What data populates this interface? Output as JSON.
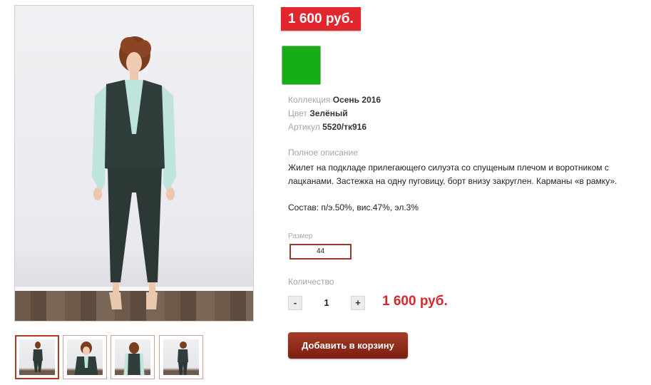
{
  "product": {
    "price_badge": "1 600 руб.",
    "color_hex": "#16ad16",
    "properties": [
      {
        "label": "Коллекция",
        "value": "Осень 2016"
      },
      {
        "label": "Цвет",
        "value": "Зелёный"
      },
      {
        "label": "Артикул",
        "value": "5520/тк916"
      }
    ],
    "description_label": "Полное описание",
    "description": "Жилет на подкладе прилегающего силуэта со спущеным плечом и воротником с лацканами. Застежка на одну пуговицу, борт внизу закруглен. Карманы «в рамку».",
    "composition": "Состав: п/э.50%, вис.47%, эл.3%",
    "size_label": "Размер",
    "size_value": "44",
    "quantity_label": "Количество",
    "quantity": "1",
    "minus": "-",
    "plus": "+",
    "total_price": "1 600 руб.",
    "add_to_cart": "Добавить в корзину"
  },
  "gallery": {
    "main_image": "model-photo-front",
    "thumbnails": [
      "model-photo-front",
      "model-photo-closeup",
      "model-photo-back",
      "model-photo-side"
    ]
  }
}
